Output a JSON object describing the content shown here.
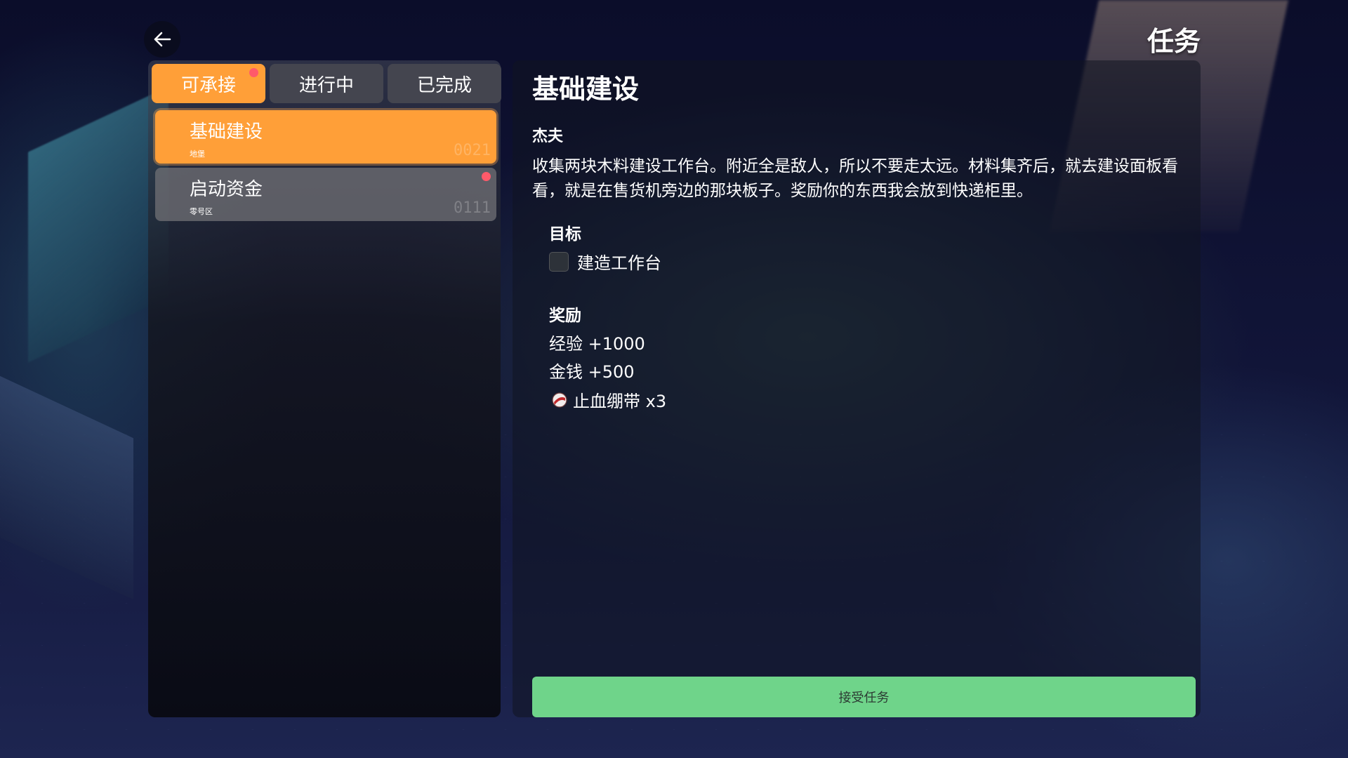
{
  "header": {
    "title": "任务",
    "back_icon": "arrow-left-icon"
  },
  "tabs": [
    {
      "label": "可承接",
      "active": true,
      "has_notification": true
    },
    {
      "label": "进行中",
      "active": false,
      "has_notification": false
    },
    {
      "label": "已完成",
      "active": false,
      "has_notification": false
    }
  ],
  "quests": [
    {
      "name": "基础建设",
      "region": "地堡",
      "code": "0021",
      "selected": true,
      "has_notification": false
    },
    {
      "name": "启动资金",
      "region": "零号区",
      "code": "0111",
      "selected": false,
      "has_notification": true
    }
  ],
  "detail": {
    "title": "基础建设",
    "giver": "杰夫",
    "description": "收集两块木料建设工作台。附近全是敌人，所以不要走太远。材料集齐后，就去建设面板看看，就是在售货机旁边的那块板子。奖励你的东西我会放到快递柜里。",
    "objectives_label": "目标",
    "objectives": [
      {
        "text": "建造工作台",
        "completed": false
      }
    ],
    "rewards_label": "奖励",
    "rewards": {
      "exp": "经验 +1000",
      "money": "金钱 +500",
      "item": "止血绷带 x3",
      "item_icon": "bandage-icon"
    },
    "accept_label": "接受任务"
  },
  "colors": {
    "accent_orange": "#ff9f38",
    "accept_green": "#6fd48a",
    "notification_red": "#ff5a6a"
  }
}
